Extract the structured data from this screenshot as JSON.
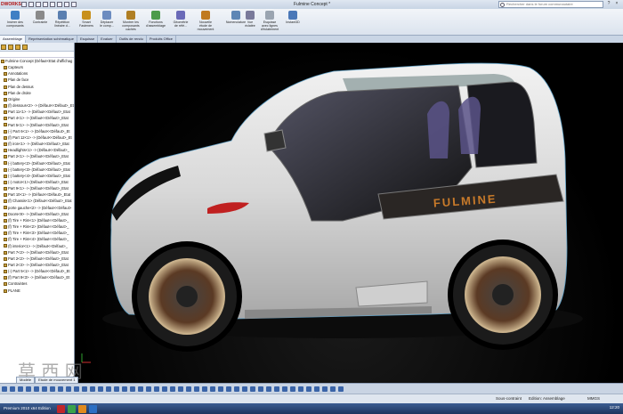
{
  "app": {
    "logo_text": "DWORKS",
    "document_title": "Fulmine Concept *",
    "search_placeholder": "Rechercher dans le forum communautaire"
  },
  "ribbon": {
    "commands": [
      {
        "label": "Insérer des\ncomposants",
        "color": "#3f7fc4"
      },
      {
        "label": "Contrainte",
        "color": "#8a8a8a"
      },
      {
        "label": "Répétition\nlinéaire d...",
        "color": "#5a7fb0"
      },
      {
        "label": "Smart\nFasteners",
        "color": "#c8901c"
      },
      {
        "label": "Déplacer\nle comp...",
        "color": "#6c8cc0"
      },
      {
        "label": "Montrer les\ncomposants\ncachés",
        "color": "#b07f24"
      },
      {
        "label": "Fonctions\nd'assemblage",
        "color": "#4b9b4b"
      },
      {
        "label": "Géométrie\nde réfé...",
        "color": "#6a6ab8"
      },
      {
        "label": "Nouvelle\nétude de\nmouvement",
        "color": "#c07a20"
      },
      {
        "label": "Nomenclature",
        "color": "#5d86b5"
      },
      {
        "label": "Vue\néclatée",
        "color": "#7a7a9a"
      },
      {
        "label": "Esquisse\navec lignes\nd'éclatement",
        "color": "#9aa4b0"
      },
      {
        "label": "Instant3D",
        "color": "#4a78b8"
      }
    ]
  },
  "tabs": [
    "Assemblage",
    "Représentation schématique",
    "Esquisse",
    "Evaluer",
    "Outils de rendu",
    "Produits Office"
  ],
  "tree": {
    "items": [
      "Fulmine Concept (Défaut<Etat d'affichag",
      "Capteurs",
      "Annotations",
      "Plan de face",
      "Plan de dessus",
      "Plan de droite",
      "Origine",
      "(f) dessous<2> -> (Défaut<<Défaut>_Et",
      "Part 11<1> -> (Défaut<<Défaut>_Etat",
      "Part 4<1> -> (Défaut<<Défaut>_Etat",
      "Part 5<1> -> (Défaut<<Défaut>_Etat",
      "(-) Part 6<1> -> (Défaut<<Défaut>_Et",
      "(f) Part 12<1> -> (Défaut<<Défaut>_Et",
      "(f) iron<1> -> (Défaut<<Défaut>_Etat",
      "Headlights<1> -> (Défaut<<Défaut>_",
      "Part 2<1> -> (Défaut<<Défaut>_Etat",
      "(-) battery<2> (Défaut<<Défaut>_Etat",
      "(-) battery<3> (Défaut<<Défaut>_Etat",
      "(-) battery<4> (Défaut<<Défaut>_Etat",
      "(-) motor<1> (Défaut<<Défaut>_Etat",
      "Part 9<1> -> (Défaut<<Défaut>_Etat",
      "Part 10<1> -> (Défaut<<Défaut>_Etat",
      "(f) Chassis<1> (Défaut<<Défaut>_Etat",
      "porte gauche<2> -> (Défaut<<Défaut>",
      "Doors<9> -> (Défaut<<Défaut>_Etat",
      "(f) Tire + Rim<1> (Défaut<<Défaut>_",
      "(f) Tire + Rim<2> (Défaut<<Défaut>_",
      "(f) Tire + Rim<3> (Défaut<<Défaut>_",
      "(f) Tire + Rim<4> (Défaut<<Défaut>_",
      "(f) interior<1> -> (Défaut<<Défaut>_",
      "Part 7<2> -> (Défaut<<Défaut>_Etat",
      "Part 2<2> -> (Défaut<<Défaut>_Etat",
      "Part 2<3> -> (Défaut<<Défaut>_Etat",
      "(-) Part 5<1> -> (Défaut<<Défaut>_Et",
      "(f) Part 8<3> -> (Défaut<<Défaut>_Et",
      "Contraintes",
      "PLANE"
    ]
  },
  "viewport": {
    "brand_on_car": "FULMINE",
    "watermark_site": "3dmox.com",
    "watermark_glyphs": "草 西 网"
  },
  "bottom": {
    "model_tabs": [
      "Modèle",
      "Etude de mouvement 1"
    ],
    "status": {
      "constraint": "Sous-contraint",
      "mode": "Edition: Assemblage",
      "units": "MMGS"
    }
  },
  "taskbar": {
    "items": [
      "Premium 2010 x64 Edition"
    ],
    "clock": "12:20"
  }
}
